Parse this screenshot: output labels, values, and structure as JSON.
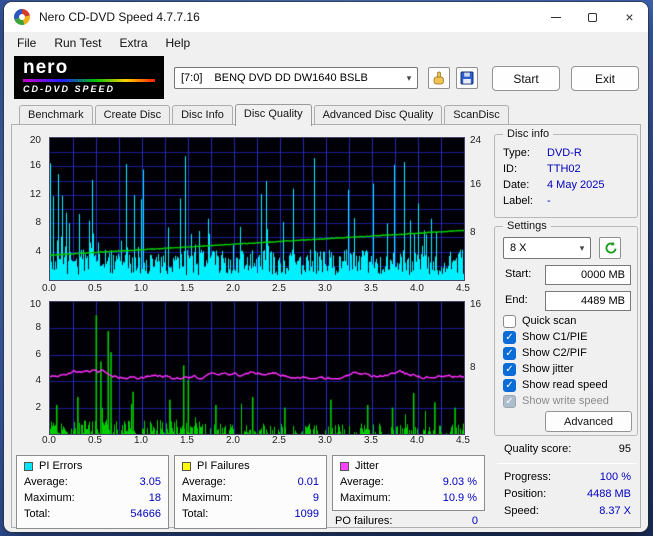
{
  "window": {
    "title": "Nero CD-DVD Speed 4.7.7.16"
  },
  "icons": {
    "close": "×",
    "dropdown": "▾",
    "check": "✓"
  },
  "menu": {
    "items": [
      {
        "label": "File"
      },
      {
        "label": "Run Test"
      },
      {
        "label": "Extra"
      },
      {
        "label": "Help"
      }
    ]
  },
  "logo": {
    "brand": "nero",
    "product": "CD-DVD SPEED"
  },
  "toolbar": {
    "drive_prefix": "[7:0]",
    "drive_name": "BENQ DVD DD DW1640 BSLB",
    "start": "Start",
    "exit": "Exit"
  },
  "tabs": [
    {
      "label": "Benchmark",
      "active": false
    },
    {
      "label": "Create Disc",
      "active": false
    },
    {
      "label": "Disc Info",
      "active": false
    },
    {
      "label": "Disc Quality",
      "active": true
    },
    {
      "label": "Advanced Disc Quality",
      "active": false
    },
    {
      "label": "ScanDisc",
      "active": false
    }
  ],
  "disc_info": {
    "title": "Disc info",
    "rows": [
      {
        "label": "Type:",
        "value": "DVD-R"
      },
      {
        "label": "ID:",
        "value": "TTH02"
      },
      {
        "label": "Date:",
        "value": "4 May 2025"
      },
      {
        "label": "Label:",
        "value": "-"
      }
    ]
  },
  "settings": {
    "title": "Settings",
    "speed": "8 X",
    "fields": [
      {
        "label": "Start:",
        "value": "0000 MB"
      },
      {
        "label": "End:",
        "value": "4489 MB"
      }
    ],
    "checkboxes": [
      {
        "label": "Quick scan",
        "checked": false,
        "disabled": false
      },
      {
        "label": "Show C1/PIE",
        "checked": true,
        "disabled": false
      },
      {
        "label": "Show C2/PIF",
        "checked": true,
        "disabled": false
      },
      {
        "label": "Show jitter",
        "checked": true,
        "disabled": false
      },
      {
        "label": "Show read speed",
        "checked": true,
        "disabled": false
      },
      {
        "label": "Show write speed",
        "checked": true,
        "disabled": true
      }
    ],
    "advanced": "Advanced"
  },
  "quality": {
    "label": "Quality score:",
    "value": "95"
  },
  "status": {
    "rows": [
      {
        "label": "Progress:",
        "value": "100 %"
      },
      {
        "label": "Position:",
        "value": "4488 MB"
      },
      {
        "label": "Speed:",
        "value": "8.37 X"
      }
    ]
  },
  "stats": {
    "boxes": [
      {
        "title": "PI Errors",
        "color": "#00e6ff",
        "rows": [
          {
            "label": "Average:",
            "value": "3.05"
          },
          {
            "label": "Maximum:",
            "value": "18"
          },
          {
            "label": "Total:",
            "value": "54666"
          }
        ]
      },
      {
        "title": "PI Failures",
        "color": "#ffff00",
        "rows": [
          {
            "label": "Average:",
            "value": "0.01"
          },
          {
            "label": "Maximum:",
            "value": "9"
          },
          {
            "label": "Total:",
            "value": "1099"
          }
        ]
      },
      {
        "title": "Jitter",
        "color": "#ff40ff",
        "rows": [
          {
            "label": "Average:",
            "value": "9.03 %"
          },
          {
            "label": "Maximum:",
            "value": "10.9 %"
          }
        ]
      }
    ],
    "po_failures": {
      "label": "PO failures:",
      "value": "0"
    }
  },
  "chart_data": [
    {
      "type": "area",
      "name": "pi-errors-and-read-speed",
      "x_unit": "GB",
      "x_max": 4.5,
      "x_ticks": [
        "0.0",
        "0.5",
        "1.0",
        "1.5",
        "2.0",
        "2.5",
        "3.0",
        "3.5",
        "4.0",
        "4.5"
      ],
      "left_axis": {
        "max": 20,
        "ticks": [
          4,
          8,
          12,
          16,
          20
        ],
        "grid_step": 2
      },
      "right_axis": {
        "max": 24,
        "ticks": [
          8,
          16,
          24
        ]
      },
      "series": [
        {
          "name": "PI Errors",
          "color": "#00f0ff",
          "average": 3.05,
          "maximum": 18,
          "total": 54666
        },
        {
          "name": "Read speed",
          "color": "#00d200",
          "axis": "right",
          "start_value": 4.2,
          "end_value": 8.37
        }
      ],
      "seed": 7
    },
    {
      "type": "area",
      "name": "pi-failures-and-jitter",
      "x_unit": "GB",
      "x_max": 4.5,
      "x_ticks": [
        "0.0",
        "0.5",
        "1.0",
        "1.5",
        "2.0",
        "2.5",
        "3.0",
        "3.5",
        "4.0",
        "4.5"
      ],
      "left_axis": {
        "max": 10,
        "ticks": [
          2,
          4,
          6,
          8,
          10
        ],
        "grid_step": 2
      },
      "right_axis": {
        "max": 16,
        "ticks": [
          8,
          16
        ]
      },
      "series": [
        {
          "name": "PI Failures",
          "color": "#00cc00",
          "average": 0.01,
          "maximum": 9,
          "total": 1099,
          "spikes": [
            [
              0.07,
              2.2
            ],
            [
              0.3,
              2.8
            ],
            [
              0.5,
              9
            ],
            [
              0.55,
              5.5
            ],
            [
              0.63,
              7.8
            ],
            [
              0.66,
              6.2
            ],
            [
              0.9,
              3.2
            ],
            [
              1.3,
              2.6
            ],
            [
              1.45,
              5.2
            ],
            [
              1.5,
              4.1
            ],
            [
              1.8,
              2.2
            ],
            [
              2.2,
              2.8
            ],
            [
              2.55,
              2.0
            ],
            [
              3.05,
              2.6
            ],
            [
              3.45,
              2.2
            ],
            [
              3.72,
              2.0
            ],
            [
              3.95,
              3.1
            ],
            [
              4.18,
              2.4
            ],
            [
              4.4,
              2.0
            ]
          ]
        },
        {
          "name": "Jitter",
          "color": "#ff2fff",
          "average_percent": 9.03,
          "maximum_percent": 10.9,
          "plot_level": 4.5
        }
      ],
      "seed": 13
    }
  ]
}
